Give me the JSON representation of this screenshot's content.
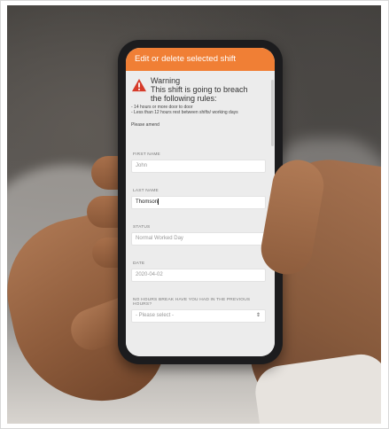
{
  "app": {
    "title": "Edit or delete selected shift",
    "accent_color": "#f07f35"
  },
  "warning": {
    "icon": "warning-triangle-icon",
    "heading": "Warning",
    "message_line1": "This shift is going to breach",
    "message_line2": "the following rules:",
    "rules": [
      "- 14 hours or more door to door",
      "- Less than 12 hours rest between shifts/ working days"
    ],
    "note": "Please amend"
  },
  "form": {
    "first_name": {
      "label": "FIRST NAME",
      "value": "John"
    },
    "last_name": {
      "label": "LAST NAME",
      "value": "Thomson"
    },
    "status": {
      "label": "STATUS",
      "value": "Normal Worked Day"
    },
    "date": {
      "label": "DATE",
      "value": "2020-04-02"
    },
    "reason": {
      "label": "NO HOURS BREAK HAVE YOU HAD IN THE PREVIOUS HOURS?",
      "value": "- Please select -"
    }
  }
}
